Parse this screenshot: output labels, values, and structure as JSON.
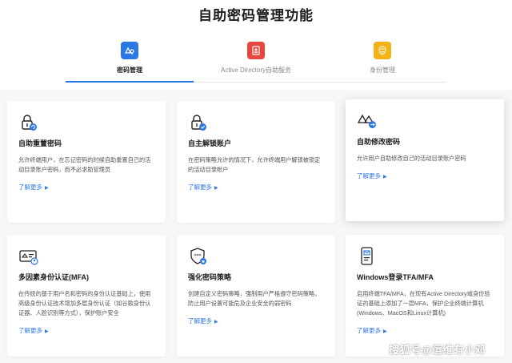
{
  "page": {
    "title": "自助密码管理功能"
  },
  "tabs": [
    {
      "label": "密码管理",
      "icon": "password-key-icon",
      "color": "#2b78e4",
      "active": true
    },
    {
      "label": "Active Directory自助服务",
      "icon": "ad-self-service-icon",
      "color": "#e8473f",
      "active": false
    },
    {
      "label": "身份管理",
      "icon": "identity-icon",
      "color": "#f2b218",
      "active": false
    }
  ],
  "cards": [
    {
      "icon": "lock-reset-icon",
      "title": "自助重置密码",
      "desc": "允许终端用户，在忘记密码的时候自助重置自己的活动目录账户密码，而不必求助管理员",
      "link": "了解更多"
    },
    {
      "icon": "lock-unlock-icon",
      "title": "自主解锁账户",
      "desc": "在密码策略允许的情况下，允许终端用户解锁被锁定的活动目录帐户",
      "link": "了解更多"
    },
    {
      "icon": "password-change-icon",
      "title": "自助修改密码",
      "desc": "允许用户自助修改自己的活动目录账户密码",
      "link": "了解更多"
    },
    {
      "icon": "mfa-id-card-icon",
      "title": "多因素身份认证(MFA)",
      "desc": "在传统的基于用户名和密码的身份认证基础上，使用高级身份认证技术增加多层身份认证（如谷歌身份认证器、人脸识别等方式），保护账户安全",
      "link": "了解更多"
    },
    {
      "icon": "shield-password-icon",
      "title": "强化密码策略",
      "desc": "创建自定义密码策略，强制用户严格遵守密码策略，防止用户设置可能危及企业安全的弱密码",
      "link": "了解更多"
    },
    {
      "icon": "windows-tfa-icon",
      "title": "Windows登录TFA/MFA",
      "desc": "启用终端TFA/MFA，在现有Active Directory域身份验证的基础上添加了一层MFA，保护企业终端计算机(Windows、MacOS和Linux计算机)",
      "link": "了解更多"
    }
  ],
  "watermark": "搜狐号@运维有小邓",
  "colors": {
    "accent": "#2b78e4",
    "title": "#1d1d1d",
    "text": "#555555",
    "background": "#f6f7f9"
  }
}
